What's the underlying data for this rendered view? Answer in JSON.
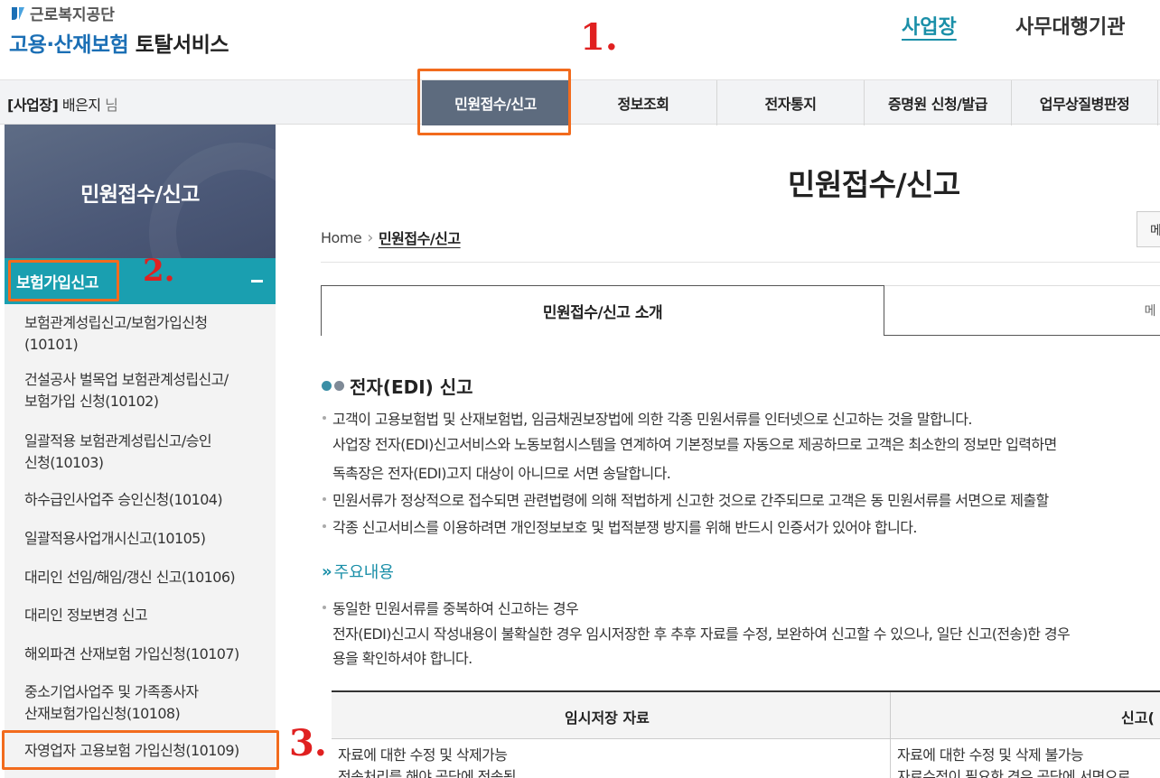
{
  "header": {
    "org_name": "근로복지공단",
    "service_blue": "고용·산재보험",
    "service_dark": "토탈서비스",
    "link_business": "사업장",
    "link_agent": "사무대행기관"
  },
  "annotations": {
    "mark1": "1.",
    "mark2": "2.",
    "mark3": "3.",
    "highlight_color": "#f26b1d",
    "ink_color": "#e02020"
  },
  "nav": {
    "user_tag": "[사업장]",
    "user_name": " 배은지",
    "user_suffix": " 님",
    "items": [
      {
        "label": "민원접수/신고",
        "active": true
      },
      {
        "label": "정보조회"
      },
      {
        "label": "전자통지"
      },
      {
        "label": "증명원 신청/발급"
      },
      {
        "label": "업무상질병판정"
      }
    ]
  },
  "sidebar": {
    "title": "민원접수/신고",
    "group_label": "보험가입신고",
    "items": [
      {
        "line1": "보험관계성립신고/보험가입신청",
        "line2": "(10101)"
      },
      {
        "line1": "건설공사 벌목업 보험관계성립신고/",
        "line2": "보험가입 신청(10102)"
      },
      {
        "line1": "일괄적용 보험관계성립신고/승인",
        "line2": "신청(10103)"
      },
      {
        "line1": "하수급인사업주 승인신청(10104)"
      },
      {
        "line1": "일괄적용사업개시신고(10105)"
      },
      {
        "line1": "대리인 선임/해임/갱신 신고(10106)"
      },
      {
        "line1": "대리인 정보변경 신고"
      },
      {
        "line1": "해외파견 산재보험 가입신청(10107)"
      },
      {
        "line1": "중소기업사업주 및 가족종사자",
        "line2": "산재보험가입신청(10108)"
      },
      {
        "line1": "자영업자 고용보험 가입신청(10109)"
      }
    ]
  },
  "main": {
    "page_title": "민원접수/신고",
    "breadcrumb": {
      "home": "Home",
      "current": "민원접수/신고"
    },
    "menu_button": "메",
    "tabs": [
      "민원접수/신고 소개",
      "메"
    ],
    "section_title": "전자(EDI) 신고",
    "paragraphs": [
      "고객이 고용보험법 및 산재보험법, 임금채권보장법에 의한 각종 민원서류를 인터넷으로 신고하는 것을 말합니다.",
      "사업장 전자(EDI)신고서비스와 노동보험시스템을 연계하여 기본정보를 자동으로 제공하므로 고객은 최소한의 정보만 입력하면",
      "독촉장은 전자(EDI)고지 대상이 아니므로 서면 송달합니다.",
      "민원서류가 정상적으로 접수되면 관련법령에 의해 적법하게 신고한 것으로 간주되므로 고객은 동 민원서류를 서면으로 제출할",
      "각종 신고서비스를 이용하려면 개인정보보호 및 법적분쟁 방지를 위해 반드시 인증서가 있어야 합니다."
    ],
    "sub_title": "주요내용",
    "sub_paragraphs": [
      "동일한 민원서류를 중복하여 신고하는 경우",
      "전자(EDI)신고시 작성내용이 불확실한 경우 임시저장한 후 추후 자료를 수정, 보완하여 신고할 수 있으나, 일단 신고(전송)한 경우",
      "용을 확인하셔야 합니다."
    ],
    "table": {
      "headers": [
        "임시저장 자료",
        "신고("
      ],
      "rows": [
        [
          "자료에 대한 수정 및 삭제가능",
          "자료에 대한 수정 및 삭제 불가능"
        ],
        [
          "전송처리를 해야 공단에 전송됨",
          "자료수정이 필요한 경우 공단에 서면으로"
        ]
      ]
    }
  }
}
